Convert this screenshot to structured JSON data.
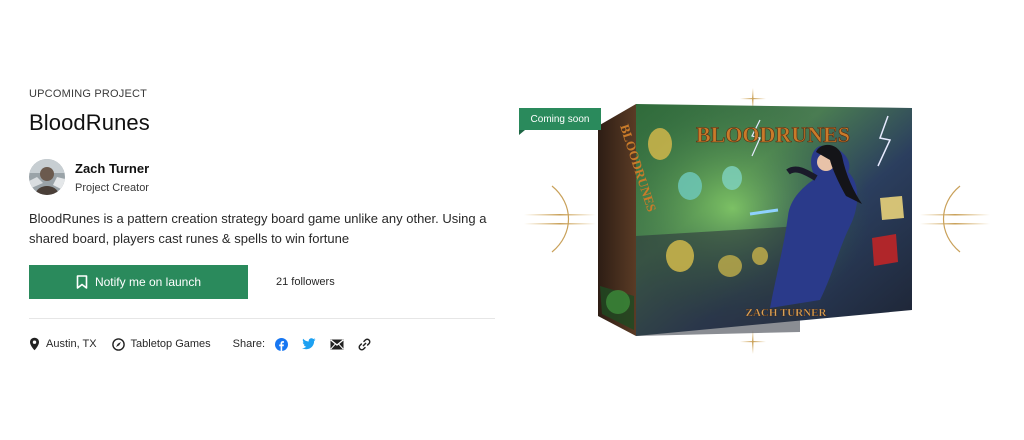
{
  "eyebrow": "UPCOMING PROJECT",
  "project": {
    "title": "BloodRunes",
    "description": "BloodRunes is a pattern creation strategy board game unlike any other. Using a shared board, players cast runes & spells to win fortune"
  },
  "creator": {
    "name": "Zach Turner",
    "role": "Project Creator"
  },
  "cta": {
    "notify_label": "Notify me on launch",
    "followers": "21 followers"
  },
  "meta": {
    "location": "Austin, TX",
    "category": "Tabletop Games",
    "share_label": "Share:"
  },
  "artwork": {
    "badge": "Coming soon",
    "box_title": "BLOODRUNES",
    "box_author": "ZACH TURNER",
    "side_title": "BLOODRUNES"
  },
  "colors": {
    "accent": "#2a8a5c",
    "facebook": "#1877f2",
    "twitter": "#1da1f2"
  },
  "icons": [
    "bookmark-icon",
    "location-pin-icon",
    "compass-icon",
    "facebook-icon",
    "twitter-icon",
    "mail-icon",
    "link-icon"
  ]
}
